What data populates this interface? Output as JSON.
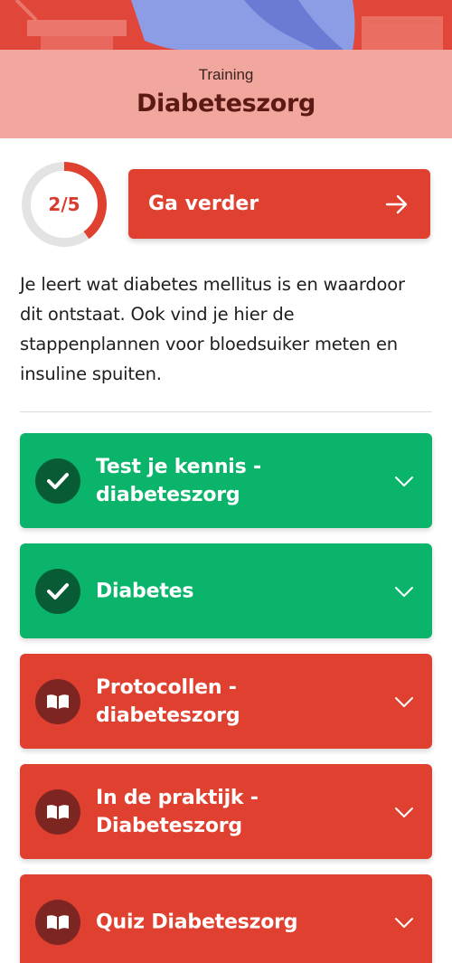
{
  "header": {
    "subtitle": "Training",
    "title": "Diabeteszorg"
  },
  "progress": {
    "label": "2/5",
    "completed": 2,
    "total": 5
  },
  "continue_button": {
    "label": "Ga verder"
  },
  "description": "Je leert wat diabetes mellitus is en waardoor dit ontstaat. Ook vind je hier de stappenplannen voor bloedsuiker meten en insuline spuiten.",
  "modules": [
    {
      "label": "Test je kennis - diabeteszorg",
      "status": "completed",
      "icon": "check-icon"
    },
    {
      "label": "Diabetes",
      "status": "completed",
      "icon": "check-icon"
    },
    {
      "label": "Protocollen - diabeteszorg",
      "status": "open",
      "icon": "book-icon"
    },
    {
      "label": "In de praktijk - Diabeteszorg",
      "status": "open",
      "icon": "book-icon"
    },
    {
      "label": "Quiz Diabeteszorg",
      "status": "open",
      "icon": "book-icon"
    }
  ],
  "colors": {
    "hero": "#e0463a",
    "title_band": "#f2a79e",
    "accent_red": "#e0402f",
    "completed_green": "#0bb46b"
  }
}
